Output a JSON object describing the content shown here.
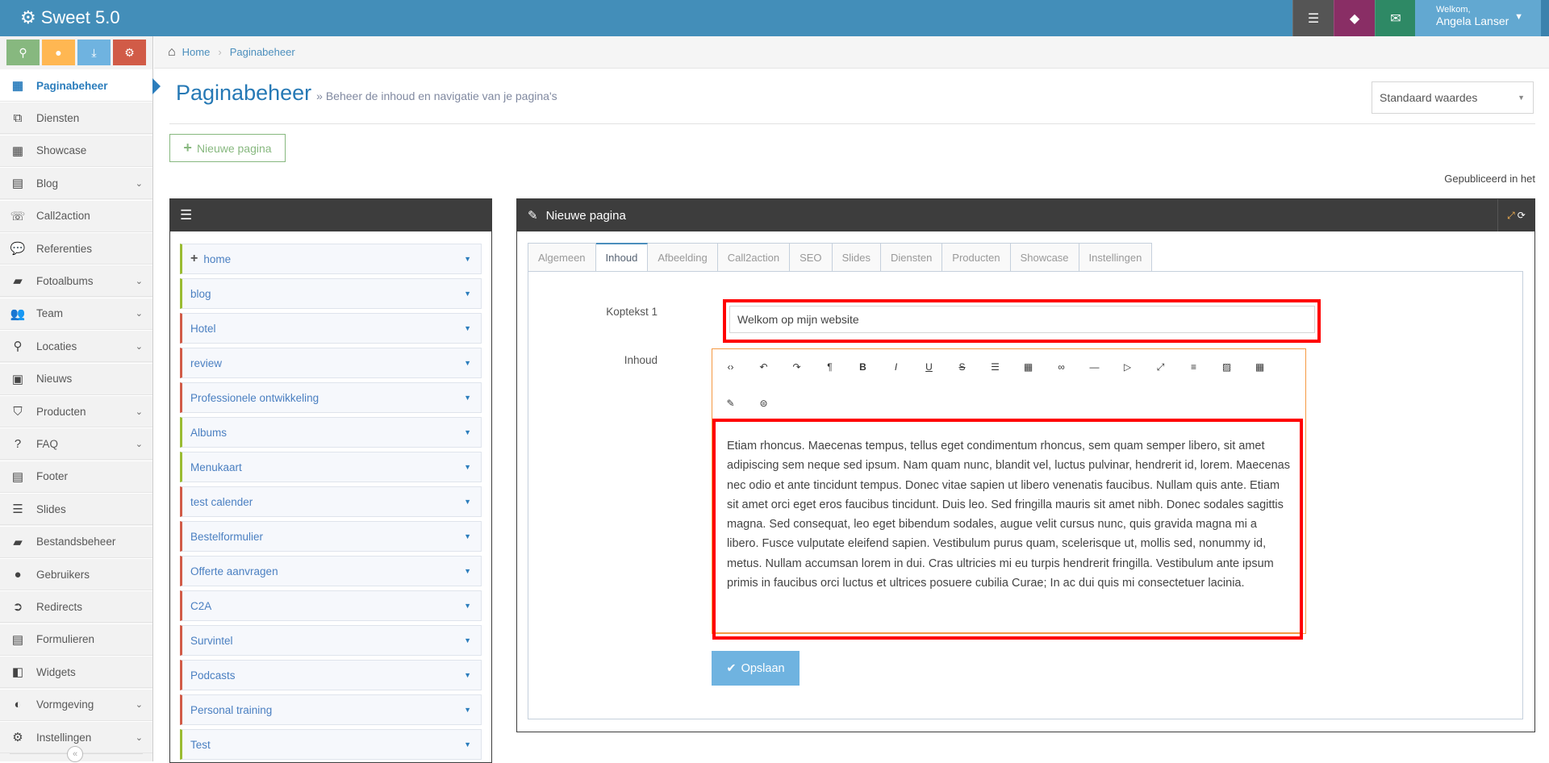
{
  "app": {
    "title": "Sweet 5.0",
    "brand_icon": "cogs-icon"
  },
  "topbar": {
    "buttons": [
      {
        "icon": "server-icon",
        "color": "#555555"
      },
      {
        "icon": "superman-icon",
        "color": "#892e65"
      },
      {
        "icon": "envelope-icon",
        "color": "#2e8965"
      }
    ],
    "user": {
      "welcome": "Welkom,",
      "name": "Angela Lanser"
    }
  },
  "shortcuts": [
    {
      "icon": "map-marker-icon",
      "color": "#87b87f"
    },
    {
      "icon": "user-icon",
      "color": "#ffb752"
    },
    {
      "icon": "download-icon",
      "color": "#6fb3e0"
    },
    {
      "icon": "cogs-icon",
      "color": "#d15b47"
    }
  ],
  "sidebar": {
    "items": [
      {
        "label": "Paginabeheer",
        "icon": "table-icon",
        "glyph": "▦",
        "active": true
      },
      {
        "label": "Diensten",
        "icon": "cubes-icon",
        "glyph": "⧉"
      },
      {
        "label": "Showcase",
        "icon": "grid-icon",
        "glyph": "▦"
      },
      {
        "label": "Blog",
        "icon": "file-icon",
        "glyph": "▤",
        "sub": true
      },
      {
        "label": "Call2action",
        "icon": "phone-icon",
        "glyph": "☏"
      },
      {
        "label": "Referenties",
        "icon": "comments-icon",
        "glyph": "💬"
      },
      {
        "label": "Fotoalbums",
        "icon": "book-icon",
        "glyph": "▰",
        "sub": true
      },
      {
        "label": "Team",
        "icon": "users-icon",
        "glyph": "👥",
        "sub": true
      },
      {
        "label": "Locaties",
        "icon": "map-marker-icon",
        "glyph": "⚲",
        "sub": true
      },
      {
        "label": "Nieuws",
        "icon": "newspaper-icon",
        "glyph": "▣"
      },
      {
        "label": "Producten",
        "icon": "tags-icon",
        "glyph": "⛉",
        "sub": true
      },
      {
        "label": "FAQ",
        "icon": "question-icon",
        "glyph": "?",
        "sub": true
      },
      {
        "label": "Footer",
        "icon": "list-alt-icon",
        "glyph": "▤"
      },
      {
        "label": "Slides",
        "icon": "sliders-icon",
        "glyph": "☰"
      },
      {
        "label": "Bestandsbeheer",
        "icon": "folder-open-icon",
        "glyph": "▰"
      },
      {
        "label": "Gebruikers",
        "icon": "user-icon",
        "glyph": "●"
      },
      {
        "label": "Redirects",
        "icon": "arrow-circle-icon",
        "glyph": "➲"
      },
      {
        "label": "Formulieren",
        "icon": "form-icon",
        "glyph": "▤"
      },
      {
        "label": "Widgets",
        "icon": "widget-icon",
        "glyph": "◧"
      },
      {
        "label": "Vormgeving",
        "icon": "palette-icon",
        "glyph": "◐",
        "sub": true
      },
      {
        "label": "Instellingen",
        "icon": "cog-icon",
        "glyph": "⚙",
        "sub": true
      }
    ],
    "collapse_icon": "double-angle-left-icon",
    "collapse_glyph": "«"
  },
  "breadcrumb": {
    "items": [
      "Home",
      "Paginabeheer"
    ]
  },
  "page": {
    "title": "Paginabeheer",
    "subtitle": "» Beheer de inhoud en navigatie van je pagina's",
    "select_value": "Standaard waardes",
    "new_page_label": "Nieuwe pagina",
    "published_text": "Gepubliceerd in het"
  },
  "pages_list": [
    {
      "label": "home",
      "status": "green",
      "expandable": true
    },
    {
      "label": "blog",
      "status": "green"
    },
    {
      "label": "Hotel",
      "status": "red"
    },
    {
      "label": "review",
      "status": "red"
    },
    {
      "label": "Professionele ontwikkeling",
      "status": "red"
    },
    {
      "label": "Albums",
      "status": "green"
    },
    {
      "label": "Menukaart",
      "status": "green"
    },
    {
      "label": "test calender",
      "status": "red"
    },
    {
      "label": "Bestelformulier",
      "status": "red"
    },
    {
      "label": "Offerte aanvragen",
      "status": "red"
    },
    {
      "label": "C2A",
      "status": "red"
    },
    {
      "label": "Survintel",
      "status": "red"
    },
    {
      "label": "Podcasts",
      "status": "red"
    },
    {
      "label": "Personal training",
      "status": "red"
    },
    {
      "label": "Test",
      "status": "green"
    }
  ],
  "editor": {
    "title": "Nieuwe pagina",
    "tabs": [
      "Algemeen",
      "Inhoud",
      "Afbeelding",
      "Call2action",
      "SEO",
      "Slides",
      "Diensten",
      "Producten",
      "Showcase",
      "Instellingen"
    ],
    "active_tab": "Inhoud",
    "koptekst_label": "Koptekst 1",
    "koptekst_value": "Welkom op mijn website",
    "inhoud_label": "Inhoud",
    "toolbar": [
      {
        "icon": "code-icon",
        "g": "‹›"
      },
      {
        "icon": "undo-icon",
        "g": "↶"
      },
      {
        "icon": "redo-icon",
        "g": "↷"
      },
      {
        "icon": "paragraph-icon",
        "g": "¶"
      },
      {
        "icon": "bold-icon",
        "g": "B"
      },
      {
        "icon": "italic-icon",
        "g": "I"
      },
      {
        "icon": "underline-icon",
        "g": "U"
      },
      {
        "icon": "strikethrough-icon",
        "g": "S"
      },
      {
        "icon": "list-icon",
        "g": "☰"
      },
      {
        "icon": "table-icon",
        "g": "▦"
      },
      {
        "icon": "link-icon",
        "g": "∞"
      },
      {
        "icon": "horizontal-rule-icon",
        "g": "—"
      },
      {
        "icon": "video-icon",
        "g": "▷"
      },
      {
        "icon": "fullscreen-icon",
        "g": "⤢"
      },
      {
        "icon": "align-icon",
        "g": "≡"
      },
      {
        "icon": "image-icon",
        "g": "▨"
      },
      {
        "icon": "grid-icon",
        "g": "▦"
      },
      {
        "icon": "plugin-icon",
        "g": "✎"
      },
      {
        "icon": "circle-icon",
        "g": "⊜"
      }
    ],
    "content": "Etiam rhoncus. Maecenas tempus, tellus eget condimentum rhoncus, sem quam semper libero, sit amet adipiscing sem neque sed ipsum. Nam quam nunc, blandit vel, luctus pulvinar, hendrerit id, lorem. Maecenas nec odio et ante tincidunt tempus. Donec vitae sapien ut libero venenatis faucibus. Nullam quis ante. Etiam sit amet orci eget eros faucibus tincidunt. Duis leo. Sed fringilla mauris sit amet nibh. Donec sodales sagittis magna. Sed consequat, leo eget bibendum sodales, augue velit cursus nunc, quis gravida magna mi a libero. Fusce vulputate eleifend sapien. Vestibulum purus quam, scelerisque ut, mollis sed, nonummy id, metus. Nullam accumsan lorem in dui. Cras ultricies mi eu turpis hendrerit fringilla. Vestibulum ante ipsum primis in faucibus orci luctus et ultrices posuere cubilia Curae; In ac dui quis mi consectetuer lacinia.",
    "save_label": "Opslaan"
  }
}
